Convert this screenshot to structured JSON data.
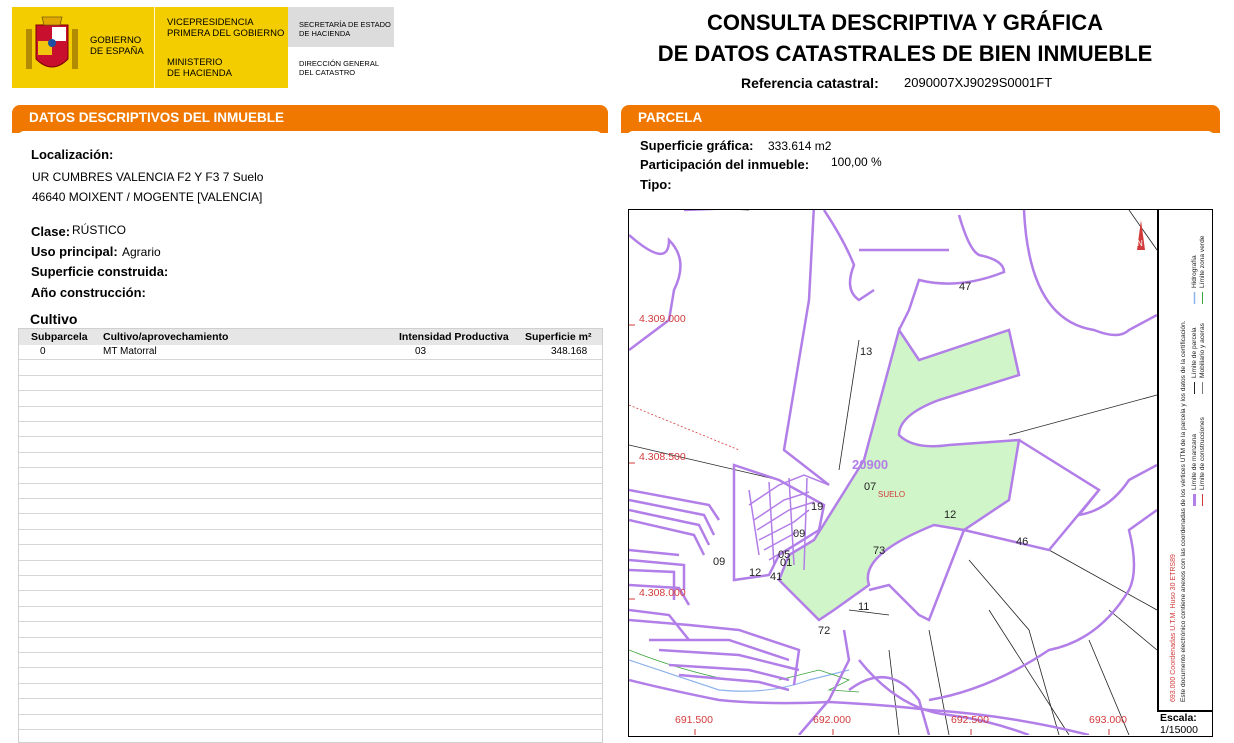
{
  "header": {
    "gov_lines": [
      "GOBIERNO",
      "DE ESPAÑA"
    ],
    "vice_lines": [
      "VICEPRESIDENCIA",
      "PRIMERA DEL GOBIERNO"
    ],
    "ministerio_lines": [
      "MINISTERIO",
      "DE HACIENDA"
    ],
    "secretaria_lines": [
      "SECRETARÍA DE ESTADO",
      "DE HACIENDA"
    ],
    "direccion_lines": [
      "DIRECCIÓN GENERAL",
      "DEL CATASTRO"
    ],
    "title_line1": "CONSULTA DESCRIPTIVA Y GRÁFICA",
    "title_line2": "DE DATOS CATASTRALES DE BIEN INMUEBLE",
    "ref_label": "Referencia catastral:",
    "ref_value": "2090007XJ9029S0001FT"
  },
  "left": {
    "section_title_a": "DATOS DESCRIPTIVOS DEL ",
    "section_title_b": "INMUEBLE",
    "localizacion_label": "Localización:",
    "localizacion_line1": "UR CUMBRES VALENCIA F2 Y F3 7 Suelo",
    "localizacion_line2": "46640 MOIXENT / MOGENTE [VALENCIA]",
    "clase_label": "Clase:",
    "clase_value": "RÚSTICO",
    "uso_label": "Uso principal:",
    "uso_value": "Agrario",
    "sup_construida_label": "Superficie construida:",
    "anio_label": "Año construcción:",
    "cultivo_title": "Cultivo",
    "table": {
      "headers": [
        "Subparcela",
        "Cultivo/aprovechamiento",
        "Intensidad Productiva",
        "Superficie m²"
      ],
      "rows": [
        [
          "0",
          "MT Matorral",
          "03",
          "348.168"
        ]
      ]
    }
  },
  "right": {
    "section_title": "PARCELA",
    "superficie_label": "Superficie gráfica:",
    "superficie_value": "333.614 m2",
    "participacion_label": "Participación del inmueble:",
    "participacion_value": "100,00 %",
    "tipo_label": "Tipo:",
    "map": {
      "y_labels": [
        "4.309.000",
        "4.308.500",
        "4.308.000"
      ],
      "x_labels": [
        "691.500",
        "692.000",
        "692.500",
        "693.000"
      ],
      "polygon_labels": [
        "47",
        "13",
        "07",
        "12",
        "46",
        "73",
        "11",
        "72",
        "09",
        "12",
        "41",
        "05",
        "01",
        "09",
        "19"
      ],
      "parcel_code": "20900",
      "suelo": "SUELO",
      "north": "N",
      "scale_label": "Escala:",
      "scale_value": "1/15000",
      "legend": {
        "coords": "693.000 Coordenadas U.T.M. Huso 30 ETRS89",
        "note": "Este documento electrónico contiene anexos con las coordenadas de los vértices UTM de la parcela y los datos de la certificación.",
        "items": [
          "Límite de manzana",
          "Límite de parcela",
          "Hidrografía",
          "Límite de construcciones",
          "Mobiliario y aceras",
          "Límite zona verde"
        ]
      },
      "colors": {
        "parcel_outline": "#b27ee8",
        "parcel_fill": "#cff5c8",
        "coord_text": "#d23b3b",
        "hydro": "#8fb4ec"
      }
    }
  }
}
